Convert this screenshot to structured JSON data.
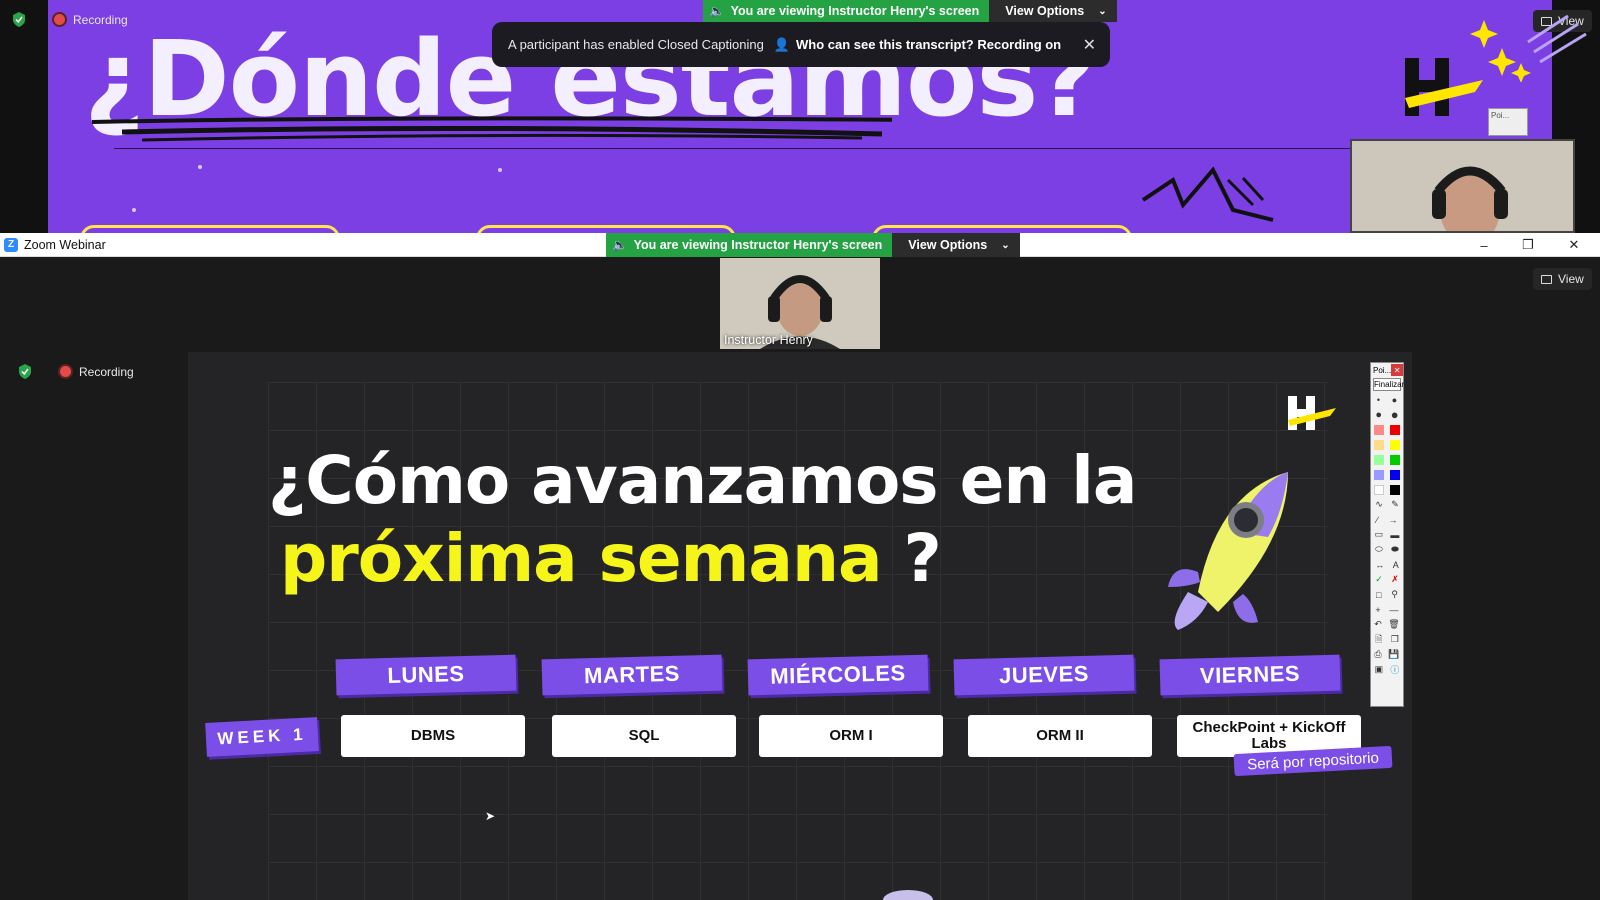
{
  "top_window": {
    "recording_label": "Recording",
    "viewing_label": "You are viewing Instructor Henry's screen",
    "view_options_label": "View Options",
    "cc_notice": "A participant has enabled Closed Captioning",
    "transcript_label": "Who can see this transcript? Recording on",
    "view_label": "View",
    "slide_title": "¿Dónde estamos?",
    "mini_toolbar_text": "Poi..."
  },
  "window": {
    "title": "Zoom Webinar",
    "viewing_label": "You are viewing Instructor Henry's screen",
    "view_options_label": "View Options",
    "view_label": "View",
    "recording_label": "Recording"
  },
  "video": {
    "participant_name": "Instructor Henry"
  },
  "slide": {
    "title_line1": "¿Cómo avanzamos en la",
    "title_highlight": "próxima semana",
    "title_end": "?",
    "week_label": "WEEK 1",
    "days": [
      {
        "day": "LUNES",
        "topic": "DBMS"
      },
      {
        "day": "MARTES",
        "topic": "SQL"
      },
      {
        "day": "MIÉRCOLES",
        "topic": "ORM I"
      },
      {
        "day": "JUEVES",
        "topic": "ORM II"
      },
      {
        "day": "VIERNES",
        "topic": "CheckPoint + KickOff Labs"
      }
    ],
    "repo_note": "Será por repositorio"
  },
  "annotation_toolbar": {
    "title": "Poi...",
    "finish_label": "Finalizar"
  },
  "colors": {
    "slide_purple": "#7b3fe4",
    "tag_purple": "#7b4ee8",
    "highlight_yellow": "#f5f51a",
    "zoom_blue": "#2d8cff",
    "viewing_green": "#25a244"
  }
}
